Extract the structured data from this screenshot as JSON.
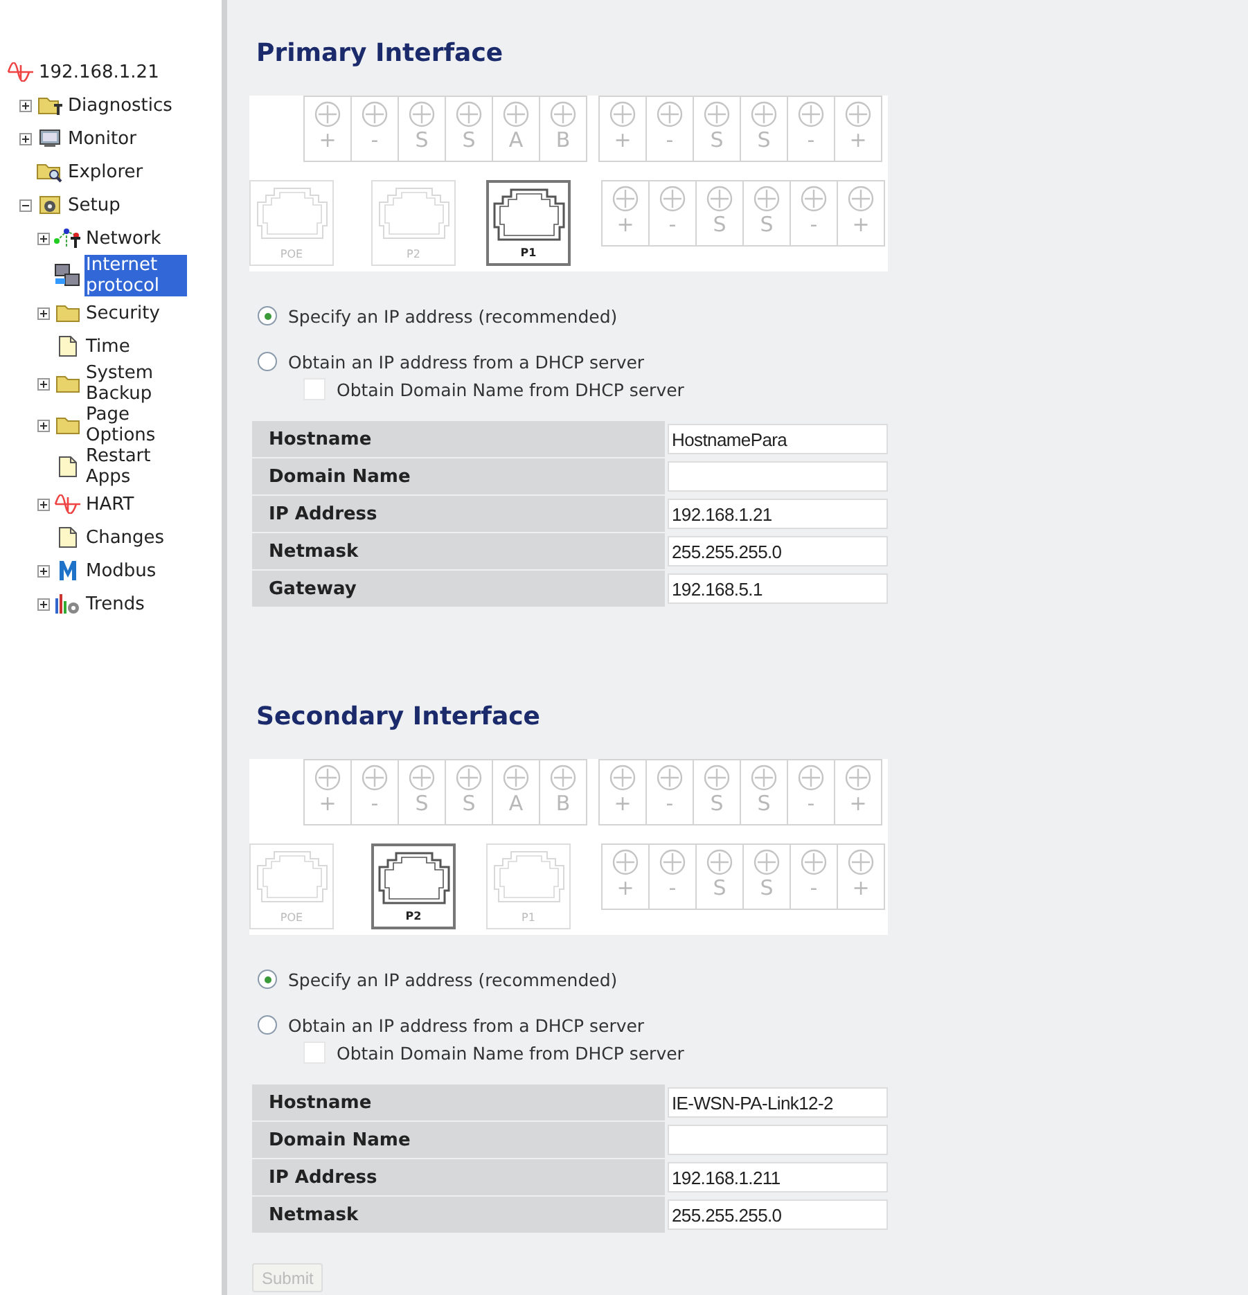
{
  "sidebar": {
    "root": {
      "label": "192.168.1.21",
      "kind": "wave",
      "selected": false,
      "children": [
        {
          "label": "Diagnostics",
          "kind": "tools",
          "selected": false,
          "expanded": false
        },
        {
          "label": "Monitor",
          "kind": "monitor",
          "selected": false,
          "expanded": false
        },
        {
          "label": "Explorer",
          "kind": "explorer",
          "selected": false
        },
        {
          "label": "Setup",
          "kind": "setup",
          "selected": false,
          "expanded": true,
          "children": [
            {
              "label": "Network",
              "kind": "network",
              "selected": false,
              "expanded": false
            },
            {
              "label": "Internet protocol",
              "kind": "computers",
              "selected": true
            },
            {
              "label": "Security",
              "kind": "folder",
              "selected": false,
              "expanded": false
            },
            {
              "label": "Time",
              "kind": "page",
              "selected": false
            },
            {
              "label": "System Backup",
              "kind": "folder",
              "selected": false,
              "expanded": false
            },
            {
              "label": "Page Options",
              "kind": "folder",
              "selected": false,
              "expanded": false
            },
            {
              "label": "Restart Apps",
              "kind": "page",
              "selected": false
            },
            {
              "label": "HART",
              "kind": "wave",
              "selected": false,
              "expanded": false
            },
            {
              "label": "Changes",
              "kind": "page",
              "selected": false
            },
            {
              "label": "Modbus",
              "kind": "modbus",
              "selected": false,
              "expanded": false
            },
            {
              "label": "Trends",
              "kind": "trends",
              "selected": false,
              "expanded": false
            }
          ]
        }
      ]
    }
  },
  "sections": [
    {
      "title": "Primary Interface",
      "device": {
        "top_terminals": [
          [
            "+",
            "-",
            "S",
            "S",
            "A",
            "B"
          ],
          [
            "+",
            "-",
            "S",
            "S",
            "-",
            "+"
          ]
        ],
        "bottom_terminals": [
          "+",
          "-",
          "S",
          "S",
          "-",
          "+"
        ],
        "ports": [
          {
            "label": "POE",
            "selected": false
          },
          {
            "label": "P2",
            "selected": false
          },
          {
            "label": "P1",
            "selected": true
          }
        ]
      },
      "ip_modes": [
        {
          "label": "Specify an IP address (recommended)",
          "selected": true
        },
        {
          "label": "Obtain an IP address from a DHCP server",
          "selected": false
        }
      ],
      "dhcp_domain": {
        "label": "Obtain Domain Name from DHCP server",
        "checked": false
      },
      "fields": [
        {
          "label": "Hostname",
          "value": "HostnamePara"
        },
        {
          "label": "Domain Name"
        },
        {
          "label": "IP Address",
          "value": "192.168.1.21"
        },
        {
          "label": "Netmask",
          "value": "255.255.255.0"
        },
        {
          "label": "Gateway",
          "value": "192.168.5.1"
        }
      ]
    },
    {
      "title": "Secondary Interface",
      "device": {
        "top_terminals": [
          [
            "+",
            "-",
            "S",
            "S",
            "A",
            "B"
          ],
          [
            "+",
            "-",
            "S",
            "S",
            "-",
            "+"
          ]
        ],
        "bottom_terminals": [
          "+",
          "-",
          "S",
          "S",
          "-",
          "+"
        ],
        "ports": [
          {
            "label": "POE",
            "selected": false
          },
          {
            "label": "P2",
            "selected": true
          },
          {
            "label": "P1",
            "selected": false
          }
        ]
      },
      "ip_modes": [
        {
          "label": "Specify an IP address (recommended)",
          "selected": true
        },
        {
          "label": "Obtain an IP address from a DHCP server",
          "selected": false
        }
      ],
      "dhcp_domain": {
        "label": "Obtain Domain Name from DHCP server",
        "checked": false
      },
      "fields": [
        {
          "label": "Hostname",
          "value": "IE-WSN-PA-Link12-2"
        },
        {
          "label": "Domain Name"
        },
        {
          "label": "IP Address",
          "value": "192.168.1.211"
        },
        {
          "label": "Netmask",
          "value": "255.255.255.0"
        }
      ]
    }
  ],
  "submit": {
    "label": "Submit",
    "disabled": true
  }
}
